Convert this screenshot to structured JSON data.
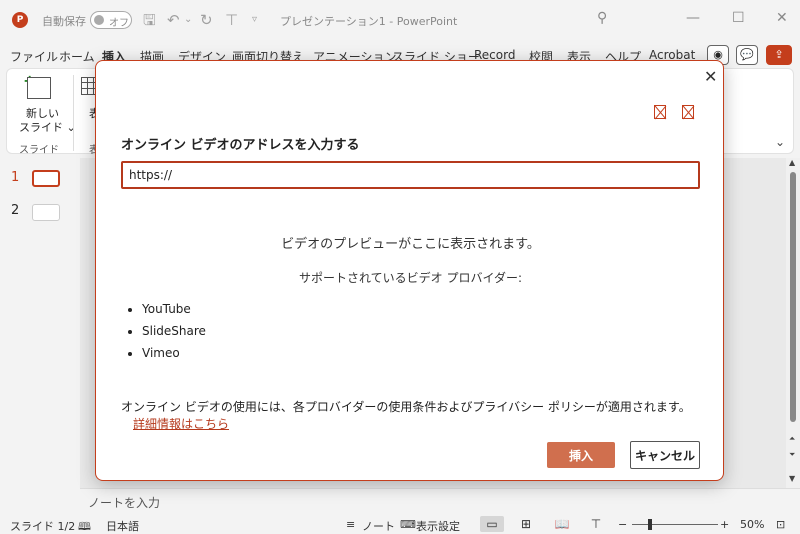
{
  "titlebar": {
    "logo": "P",
    "autosave_label": "自動保存",
    "autosave_state": "オフ",
    "doc_title": "プレゼンテーション1 - PowerPoint"
  },
  "menu": {
    "items": [
      "ファイル",
      "ホーム",
      "挿入",
      "描画",
      "デザイン",
      "画面切り替え",
      "アニメーション",
      "スライド ショー",
      "Record",
      "校閲",
      "表示",
      "ヘルプ",
      "Acrobat"
    ],
    "active": "挿入"
  },
  "ribbon": {
    "new_slide_label_1": "新しい",
    "new_slide_label_2": "スライド ⌄",
    "slides_group": "スライド",
    "table_label": "表",
    "table_group": "表"
  },
  "slides": [
    {
      "number": "1"
    },
    {
      "number": "2"
    }
  ],
  "notes_placeholder": "ノートを入力",
  "statusbar": {
    "slide_info": "スライド 1/2",
    "language": "日本語",
    "notes": "ノート",
    "display_settings": "表示設定",
    "zoom": "50%"
  },
  "dialog": {
    "heading": "オンライン ビデオのアドレスを入力する",
    "url_value": "https://",
    "preview_text": "ビデオのプレビューがここに表示されます。",
    "supported_text": "サポートされているビデオ プロバイダー:",
    "providers": [
      "YouTube",
      "SlideShare",
      "Vimeo"
    ],
    "terms_text": "オンライン ビデオの使用には、各プロバイダーの使用条件およびプライバシー ポリシーが適用されます。",
    "more_info_link": "詳細情報はこちら",
    "insert_label": "挿入",
    "cancel_label": "キャンセル"
  },
  "colors": {
    "accent": "#c43e1c",
    "insert_button": "#d06f4e"
  }
}
